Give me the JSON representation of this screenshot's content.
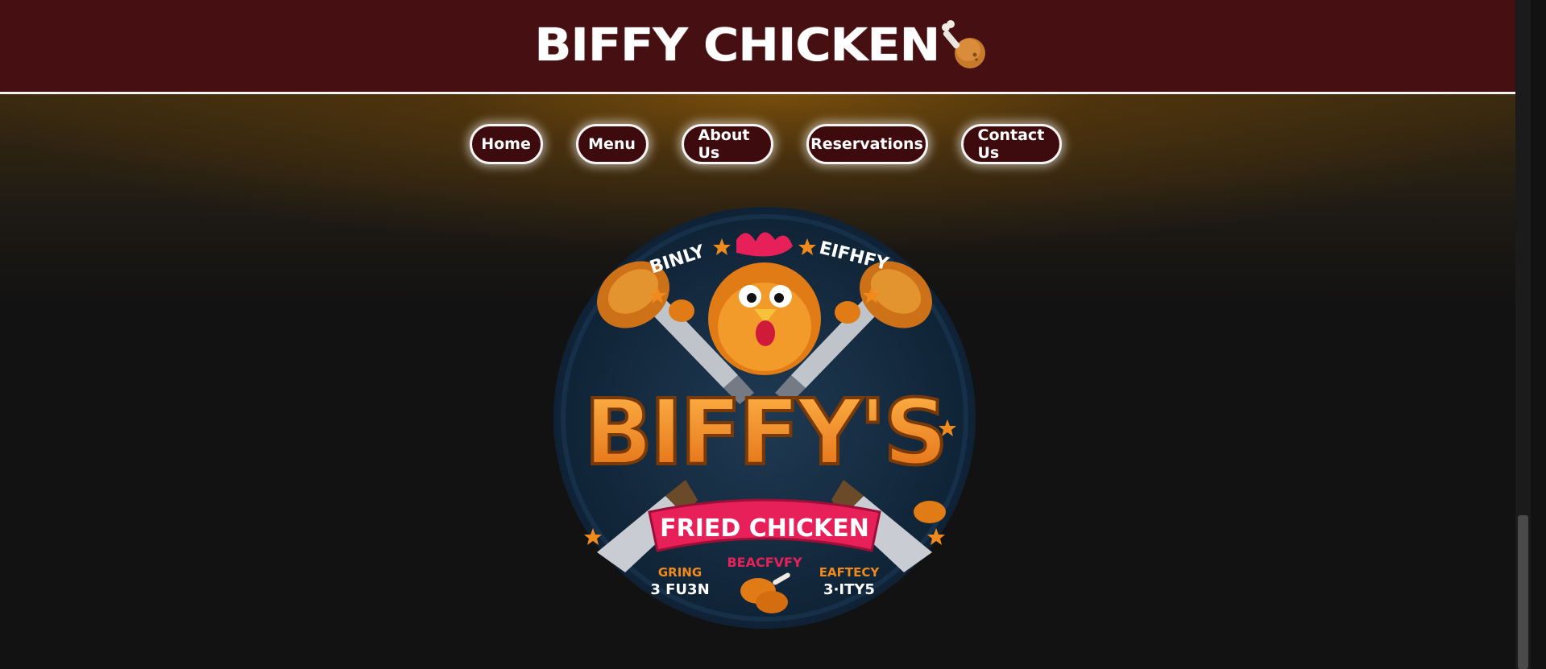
{
  "header": {
    "title": "BIFFY CHICKEN",
    "icon": "drumstick-icon"
  },
  "nav": {
    "items": [
      {
        "label": "Home"
      },
      {
        "label": "Menu"
      },
      {
        "label": "About Us"
      },
      {
        "label": "Reservations"
      },
      {
        "label": "Contact Us"
      }
    ]
  },
  "logo": {
    "main_text": "BIFFY'S",
    "banner_text": "FRIED CHICKEN",
    "top_left_text": "BINLY",
    "top_right_text": "EIFHFY",
    "bottom_center_text": "BEACFVFY",
    "bottom_left_top": "GRING",
    "bottom_left_bottom": "3 FU3N",
    "bottom_right_top": "EAFTECY",
    "bottom_right_bottom": "3·ITY5"
  },
  "colors": {
    "header_bg": "#460f11",
    "nav_button_bg": "#3d0a0d",
    "page_bg": "#121212",
    "accent_orange": "#f08a1c",
    "banner_pink": "#e8205a"
  }
}
